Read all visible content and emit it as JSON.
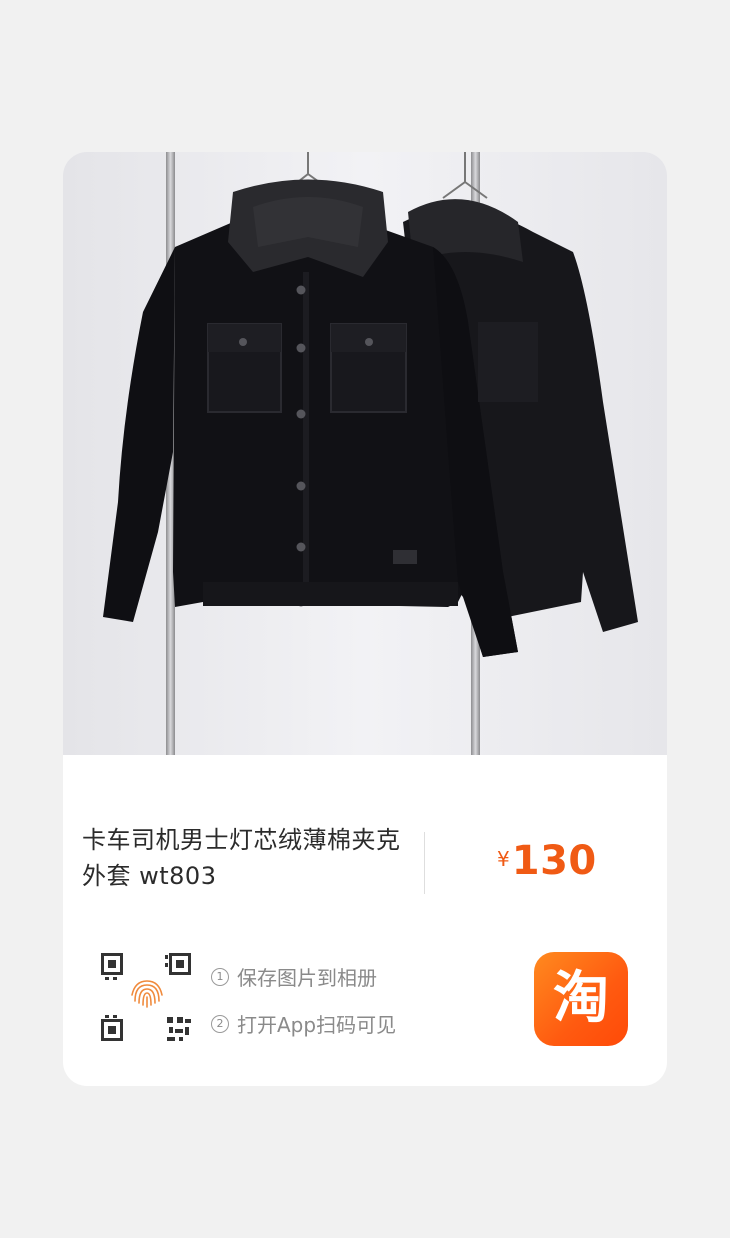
{
  "product": {
    "title": "卡车司机男士灯芯绒薄棉夹克外套 wt803",
    "currency_symbol": "¥",
    "price": "130"
  },
  "share": {
    "step1_number": "1",
    "step1_text": "保存图片到相册",
    "step2_number": "2",
    "step2_text": "打开App扫码可见"
  },
  "app_logo": {
    "glyph": "淘"
  },
  "icons": {
    "qr": "qr-code-icon",
    "fingerprint": "fingerprint-icon",
    "app": "taobao-app-icon"
  },
  "colors": {
    "price": "#f05a14",
    "logo_bg": "#ff5a10",
    "page_bg": "#f1f1f1"
  }
}
